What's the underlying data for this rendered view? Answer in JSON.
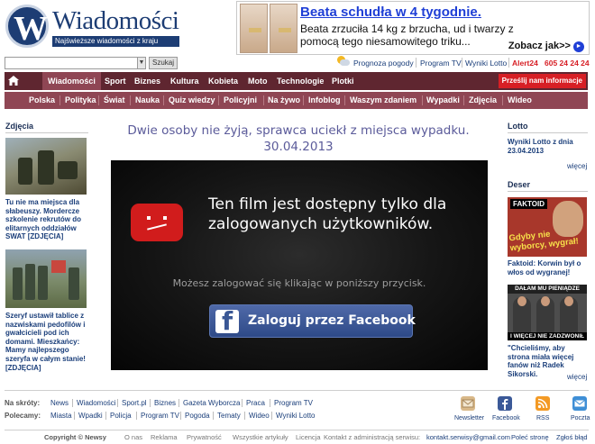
{
  "logo": {
    "letter": "W",
    "name": "Wiadomości",
    "tagline": "Najświeższe wiadomości z kraju"
  },
  "ad": {
    "title": "Beata schudła w 4 tygodnie.",
    "body": "Beata zrzuciła 14 kg z brzucha, ud i twarzy z pomocą tego niesamowitego triku...",
    "more": "Zobacz jak>>",
    "more_icon": "►"
  },
  "search": {
    "value": "",
    "dropdown_icon": "▼",
    "button_label": "Szukaj"
  },
  "toplinks": {
    "weather": "Prognoza pogody",
    "tv": "Program TV",
    "lotto": "Wyniki Lotto",
    "alert": "Alert24",
    "phone": "605 24 24 24"
  },
  "nav_main": {
    "items": [
      "Wiadomości",
      "Sport",
      "Biznes",
      "Kultura",
      "Kobieta",
      "Moto",
      "Technologie",
      "Plotki"
    ],
    "active": "Wiadomości",
    "notify": "Prześlij nam informacje"
  },
  "nav_sub": {
    "items": [
      "Polska",
      "Polityka",
      "Świat",
      "Nauka",
      "Quiz wiedzy",
      "Policyjni",
      "Na żywo",
      "Infoblog",
      "Waszym zdaniem",
      "Wypadki",
      "Zdjęcia",
      "Wideo"
    ]
  },
  "left": {
    "heading": "Zdjęcia",
    "story1": "Tu nie ma miejsca dla słabeuszy. Mordercze szkolenie rekrutów do elitarnych oddziałów SWAT [ZDJĘCIA]",
    "story2": "Szeryf ustawił tablice z nazwiskami pedofilów i gwałcicieli pod ich domami. Mieszkańcy: Mamy najlepszego szeryfa w całym stanie! [ZDJĘCIA]"
  },
  "center": {
    "headline_line1": "Dwie osoby nie żyją, sprawca uciekł z miejsca wypadku.",
    "headline_line2": "30.04.2013",
    "video_msg": "Ten film jest dostępny tylko dla zalogowanych użytkowników.",
    "video_sub": "Możesz zalogować się klikając w poniższy przycisk.",
    "fb_letter": "f",
    "fb_button": "Zaloguj przez Facebook"
  },
  "right": {
    "lotto_heading": "Lotto",
    "lotto_text": "Wyniki Lotto z dnia 23.04.2013",
    "more": "więcej",
    "deser_heading": "Deser",
    "deser1_banner": "FAKTOID",
    "deser1_shout": "Gdyby nie wyborcy, wygrał!",
    "deser1_text": "Faktoid: Korwin był o włos od wygranej!",
    "deser2_top": "DAŁAM MU PIENIĄDZE",
    "deser2_bottom": "I WIĘCEJ NIE ZADZWONIŁ",
    "deser2_text": "\"Chcieliśmy, aby strona miała więcej fanów niż Radek Sikorski."
  },
  "footer": {
    "skroty_label": "Na skróty:",
    "skroty": [
      "News",
      "Wiadomości",
      "Sport.pl",
      "Biznes",
      "Gazeta Wyborcza",
      "Praca",
      "Program TV"
    ],
    "polecamy_label": "Polecamy:",
    "polecamy": [
      "Miasta",
      "Wpadki",
      "Policja",
      "Program TV",
      "Pogoda",
      "Tematy",
      "Wideo",
      "Wyniki Lotto"
    ],
    "icons": [
      "Newsletter",
      "Facebook",
      "RSS",
      "Poczta"
    ],
    "copyright": "Copyright © Newsy",
    "bottom_links": [
      "O nas",
      "Reklama",
      "Prywatność",
      "Wszystkie artykuły",
      "Licencja"
    ],
    "contact_label": "Kontakt z administracją serwisu:",
    "contact_email": "kontakt.serwisy@gmail.com",
    "home": "Poleć stronę",
    "report": "Zgłoś błąd"
  },
  "colors": {
    "nav_main": "#5f2630",
    "nav_sub": "#8f4654",
    "link": "#1a3e7a",
    "alert": "#d71f25"
  }
}
